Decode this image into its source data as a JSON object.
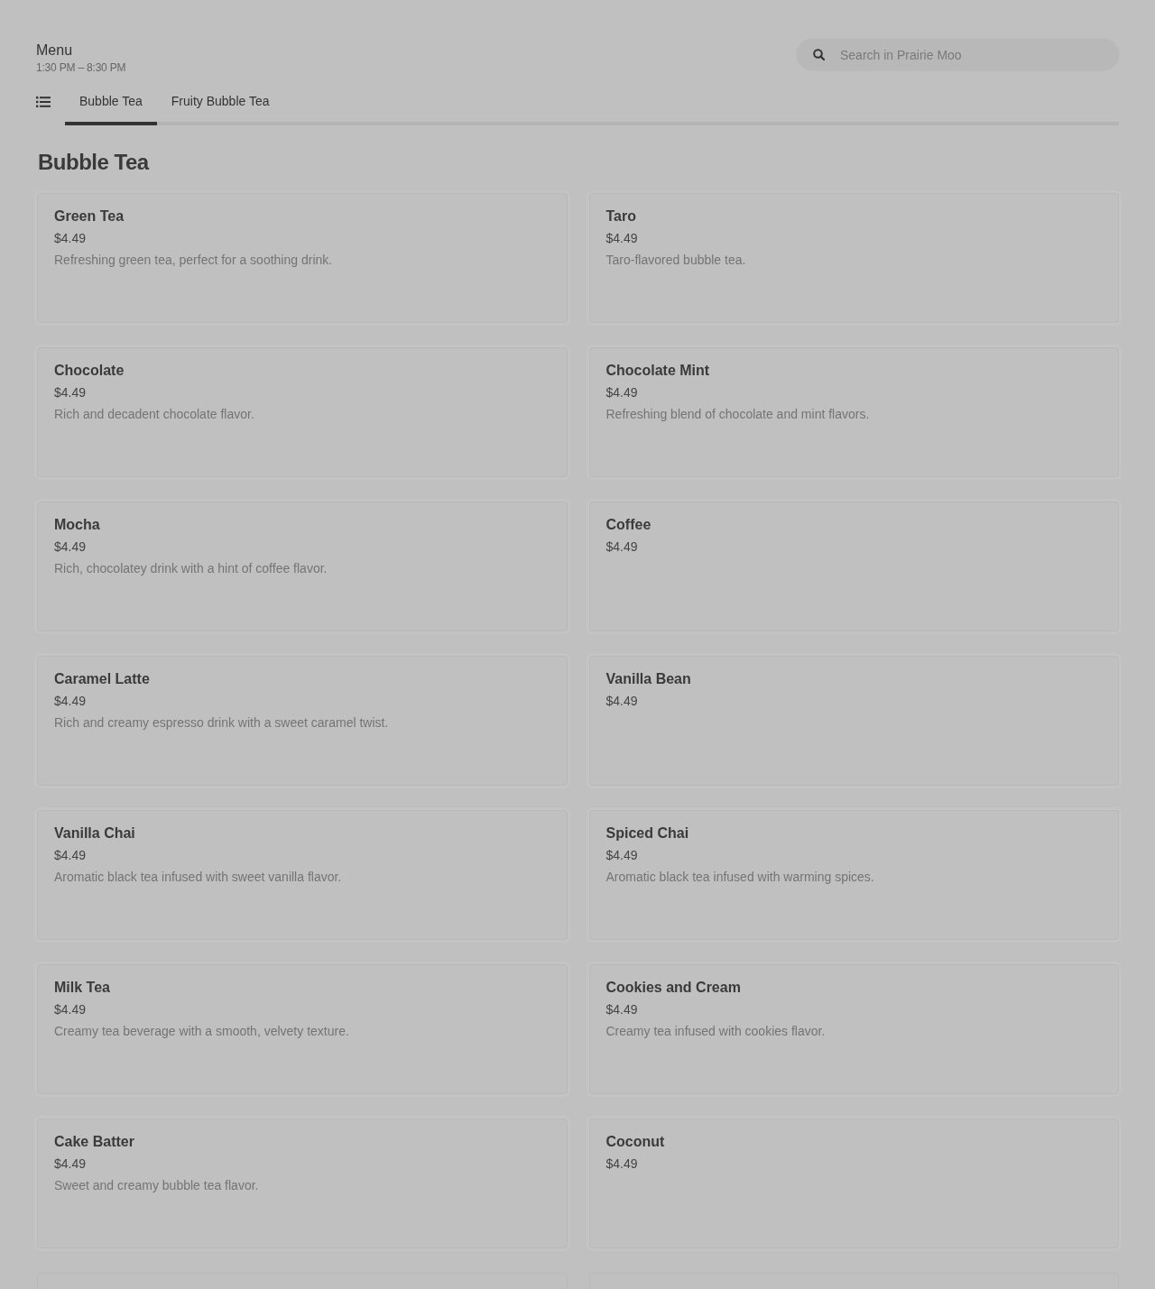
{
  "header": {
    "title": "Menu",
    "hours": "1:30 PM – 8:30 PM"
  },
  "search": {
    "placeholder": "Search in Prairie Moo"
  },
  "tabs": [
    {
      "label": "Bubble Tea",
      "selected": true
    },
    {
      "label": "Fruity Bubble Tea",
      "selected": false
    }
  ],
  "section": {
    "title": "Bubble Tea",
    "items": [
      {
        "kind": "item",
        "name": "Green Tea",
        "price": "$4.49",
        "description": "Refreshing green tea, perfect for a soothing drink."
      },
      {
        "kind": "item",
        "name": "Taro",
        "price": "$4.49",
        "description": "Taro-flavored bubble tea."
      },
      {
        "kind": "item",
        "name": "Chocolate",
        "price": "$4.49",
        "description": "Rich and decadent chocolate flavor."
      },
      {
        "kind": "item",
        "name": "Chocolate Mint",
        "price": "$4.49",
        "description": "Refreshing blend of chocolate and mint flavors."
      },
      {
        "kind": "item",
        "name": "Mocha",
        "price": "$4.49",
        "description": "Rich, chocolatey drink with a hint of coffee flavor."
      },
      {
        "kind": "item",
        "name": "Coffee",
        "price": "$4.49"
      },
      {
        "kind": "item",
        "name": "Caramel Latte",
        "price": "$4.49",
        "description": "Rich and creamy espresso drink with a sweet caramel twist."
      },
      {
        "kind": "item",
        "name": "Vanilla Bean",
        "price": "$4.49"
      },
      {
        "kind": "item",
        "name": "Vanilla Chai",
        "price": "$4.49",
        "description": "Aromatic black tea infused with sweet vanilla flavor."
      },
      {
        "kind": "item",
        "name": "Spiced Chai",
        "price": "$4.49",
        "description": "Aromatic black tea infused with warming spices."
      },
      {
        "kind": "item",
        "name": "Milk Tea",
        "price": "$4.49",
        "description": "Creamy tea beverage with a smooth, velvety texture."
      },
      {
        "kind": "item",
        "name": "Cookies and Cream",
        "price": "$4.49",
        "description": "Creamy tea infused with cookies flavor."
      },
      {
        "kind": "item",
        "name": "Cake Batter",
        "price": "$4.49",
        "description": "Sweet and creamy bubble tea flavor."
      },
      {
        "kind": "item",
        "name": "Coconut",
        "price": "$4.49"
      },
      {
        "kind": "cut_off"
      },
      {
        "kind": "cut_off"
      }
    ]
  }
}
